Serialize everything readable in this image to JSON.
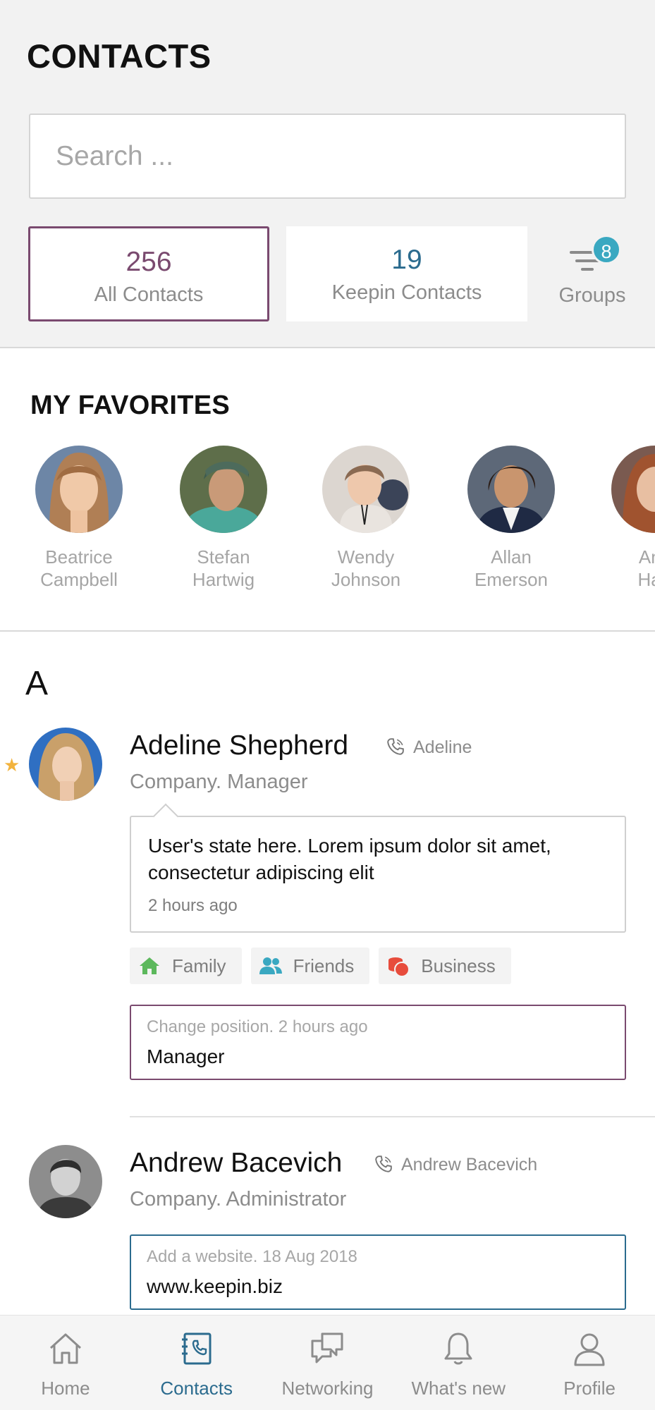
{
  "header": {
    "title": "CONTACTS"
  },
  "search": {
    "placeholder": "Search ..."
  },
  "stats": [
    {
      "count": "256",
      "label": "All Contacts",
      "selected": true
    },
    {
      "count": "19",
      "label": "Keepin Contacts",
      "selected": false
    }
  ],
  "groups": {
    "label": "Groups",
    "badge": "8"
  },
  "favorites": {
    "title": "MY FAVORITES",
    "items": [
      {
        "first": "Beatrice",
        "last": "Campbell"
      },
      {
        "first": "Stefan",
        "last": "Hartwig"
      },
      {
        "first": "Wendy",
        "last": "Johnson"
      },
      {
        "first": "Allan",
        "last": "Emerson"
      },
      {
        "first": "Ang",
        "last": "Hart"
      }
    ]
  },
  "section_letter": "A",
  "contacts": [
    {
      "name": "Adeline Shepherd",
      "phone_name": "Adeline",
      "role": "Company. Manager",
      "favorite": true,
      "status": {
        "text": "User's state here. Lorem ipsum dolor sit amet, consectetur adipiscing elit",
        "time": "2 hours ago"
      },
      "tags": [
        {
          "label": "Family",
          "icon": "home-icon",
          "color": "#5cb85c"
        },
        {
          "label": "Friends",
          "icon": "users-icon",
          "color": "#3aa8c1"
        },
        {
          "label": "Business",
          "icon": "coins-icon",
          "color": "#e74c3c"
        }
      ],
      "update": {
        "label": "Change position. 2 hours ago",
        "value": "Manager"
      }
    },
    {
      "name": "Andrew Bacevich",
      "phone_name": "Andrew Bacevich",
      "role": "Company. Administrator",
      "favorite": false,
      "update": {
        "label": "Add a website. 18 Aug 2018",
        "value": "www.keepin.biz"
      }
    }
  ],
  "nav": [
    {
      "label": "Home",
      "icon": "home-icon",
      "active": false
    },
    {
      "label": "Contacts",
      "icon": "contacts-book-icon",
      "active": true
    },
    {
      "label": "Networking",
      "icon": "chat-bubbles-icon",
      "active": false
    },
    {
      "label": "What's new",
      "icon": "bell-icon",
      "active": false
    },
    {
      "label": "Profile",
      "icon": "user-icon",
      "active": false
    }
  ],
  "colors": {
    "accent_purple": "#7a4a6f",
    "accent_blue": "#2b6b8e",
    "badge": "#3aa8c1",
    "star": "#f2b33d"
  }
}
